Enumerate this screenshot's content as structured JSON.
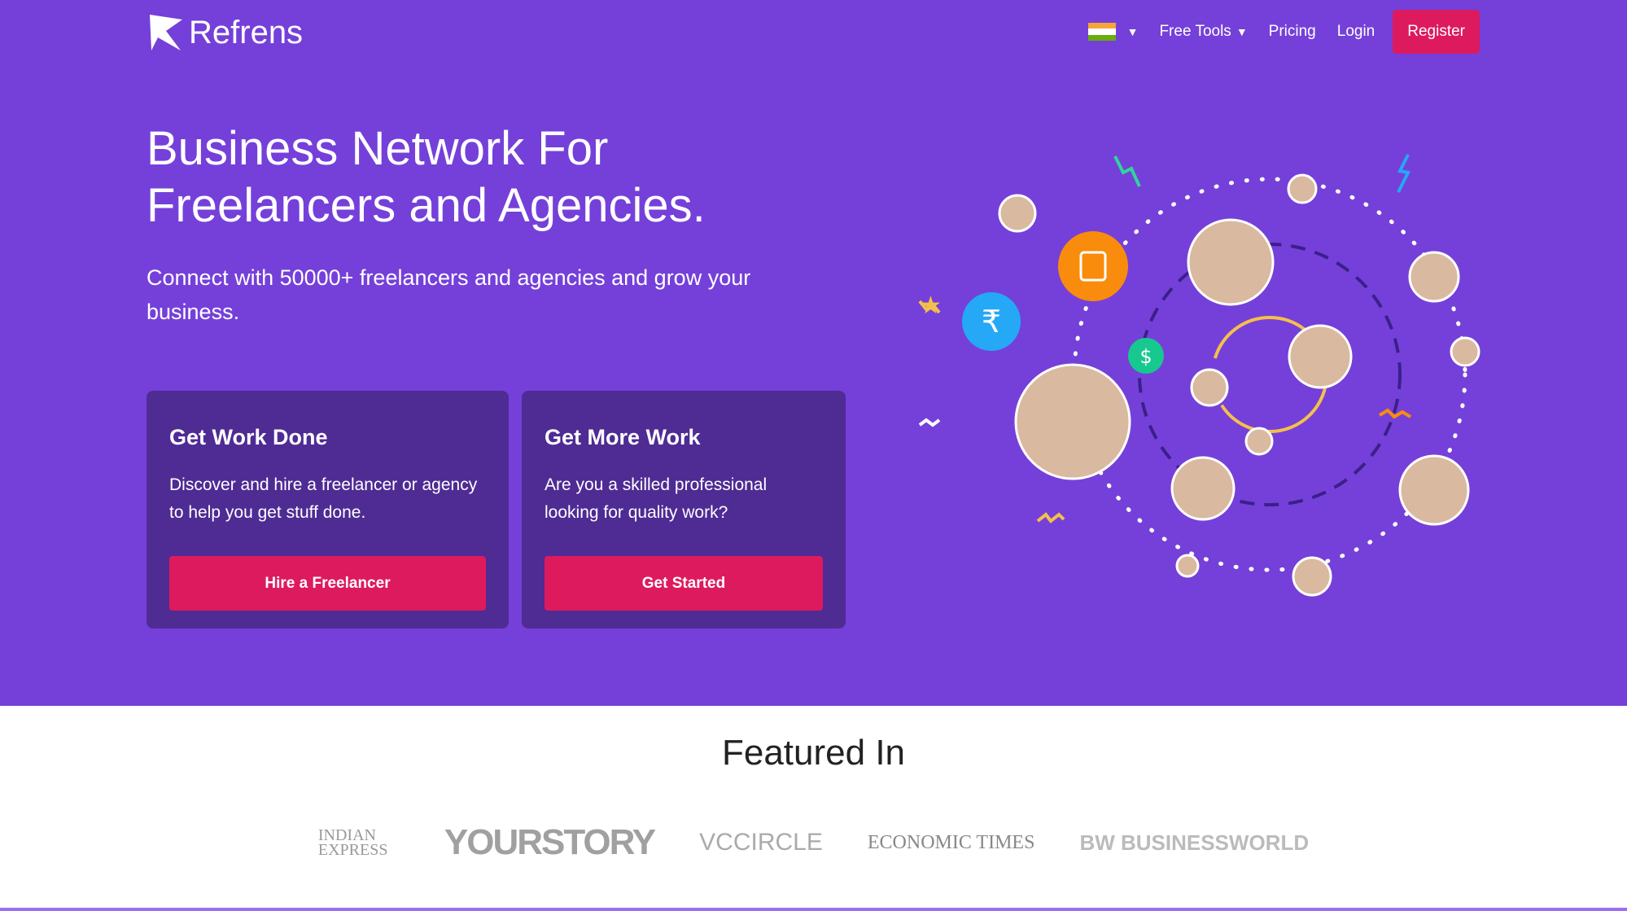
{
  "header": {
    "brand": "Refrens",
    "free_tools": "Free Tools",
    "pricing": "Pricing",
    "login": "Login",
    "register": "Register",
    "country_flag": "india-flag"
  },
  "hero": {
    "title_line1": "Business Network For",
    "title_line2": "Freelancers and Agencies.",
    "subtitle": "Connect with 50000+ freelancers and agencies and grow your business."
  },
  "cards": [
    {
      "title": "Get Work Done",
      "text": "Discover and hire a freelancer or agency to help you get stuff done.",
      "button": "Hire a Freelancer"
    },
    {
      "title": "Get More Work",
      "text": "Are you a skilled professional looking for quality work?",
      "button": "Get Started"
    }
  ],
  "featured": {
    "title": "Featured In",
    "logos": [
      "INDIAN EXPRESS",
      "YOURSTORY",
      "VCCIRCLE",
      "ECONOMIC TIMES",
      "BW BUSINESSWORLD"
    ]
  },
  "colors": {
    "background": "#7540d9",
    "card": "#4f2b94",
    "accent": "#dd1a5d"
  }
}
